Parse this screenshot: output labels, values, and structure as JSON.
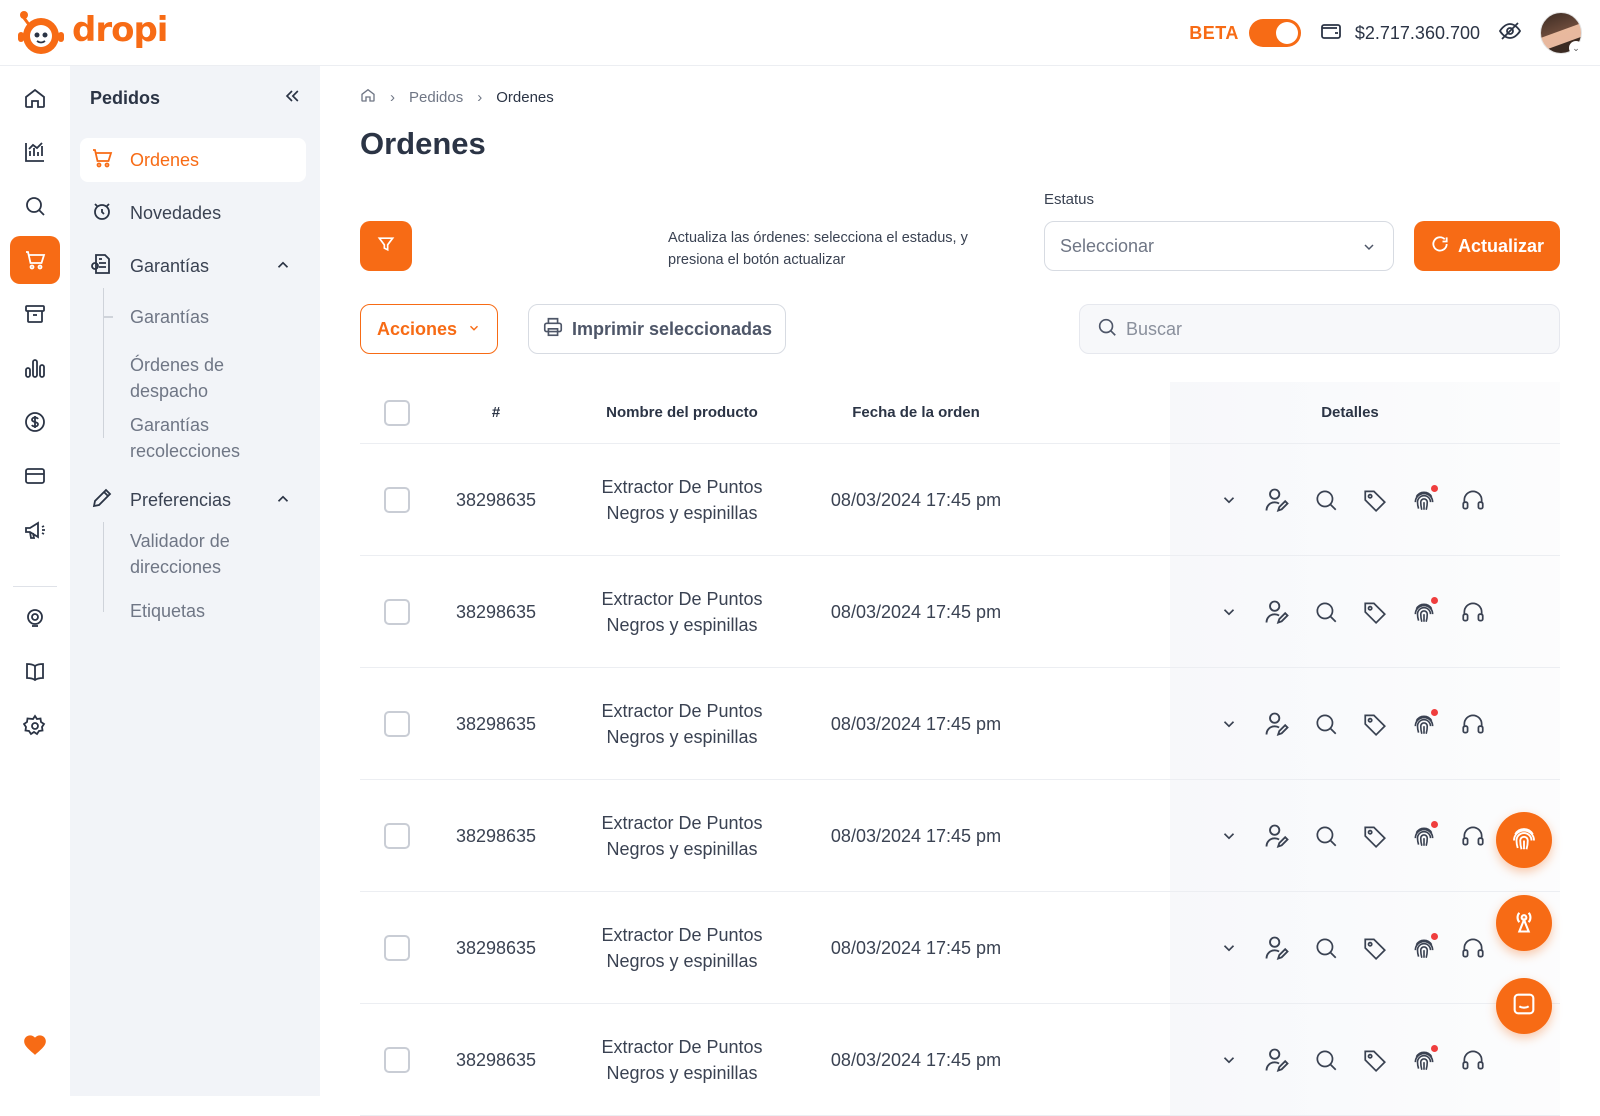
{
  "brand": {
    "name": "dropi",
    "color": "#f76b15"
  },
  "topbar": {
    "beta_label": "BETA",
    "beta_enabled": true,
    "balance": "$2.717.360.700",
    "wallet_icon": "wallet-icon",
    "hide_balance_icon": "eye-off-icon"
  },
  "rail": {
    "items": [
      "home-icon",
      "chart-icon",
      "search-icon",
      "cart-icon",
      "archive-icon",
      "bars-icon",
      "dollar-icon",
      "card-icon",
      "megaphone-icon",
      "support-icon",
      "book-icon",
      "gear-icon"
    ],
    "active": "cart-icon",
    "footer_icon": "heart-icon"
  },
  "sidebar": {
    "title": "Pedidos",
    "items": [
      {
        "label": "Ordenes",
        "icon": "cart-icon",
        "active": true
      },
      {
        "label": "Novedades",
        "icon": "clock-refresh-icon"
      },
      {
        "label": "Garantías",
        "icon": "document-icon",
        "expanded": true,
        "children": [
          "Garantías",
          "Órdenes de despacho",
          "Garantías recolecciones"
        ]
      },
      {
        "label": "Preferencias",
        "icon": "pencil-icon",
        "expanded": true,
        "children": [
          "Validador de direcciones",
          "Etiquetas"
        ]
      }
    ]
  },
  "breadcrumb": {
    "items": [
      "Pedidos",
      "Ordenes"
    ]
  },
  "page": {
    "title": "Ordenes",
    "hint": "Actualiza las órdenes: selecciona el estadus, y presiona el botón actualizar",
    "status_label": "Estatus",
    "status_placeholder": "Seleccionar",
    "update_label": "Actualizar",
    "actions_label": "Acciones",
    "print_label": "Imprimir seleccionadas",
    "search_placeholder": "Buscar"
  },
  "table": {
    "columns": [
      "#",
      "Nombre del producto",
      "Fecha de la orden",
      "Detalles"
    ],
    "rows": [
      {
        "id": "38298635",
        "product_line1": "Extractor De Puntos",
        "product_line2": "Negros y espinillas",
        "date": "08/03/2024 17:45 pm"
      },
      {
        "id": "38298635",
        "product_line1": "Extractor De Puntos",
        "product_line2": "Negros y espinillas",
        "date": "08/03/2024 17:45 pm"
      },
      {
        "id": "38298635",
        "product_line1": "Extractor De Puntos",
        "product_line2": "Negros y espinillas",
        "date": "08/03/2024 17:45 pm"
      },
      {
        "id": "38298635",
        "product_line1": "Extractor De Puntos",
        "product_line2": "Negros y espinillas",
        "date": "08/03/2024 17:45 pm"
      },
      {
        "id": "38298635",
        "product_line1": "Extractor De Puntos",
        "product_line2": "Negros y espinillas",
        "date": "08/03/2024 17:45 pm"
      },
      {
        "id": "38298635",
        "product_line1": "Extractor De Puntos",
        "product_line2": "Negros y espinillas",
        "date": "08/03/2024 17:45 pm"
      }
    ],
    "row_icons": [
      "chevron-down-icon",
      "user-edit-icon",
      "magnifier-icon",
      "tag-icon",
      "fingerprint-icon",
      "headset-icon"
    ]
  },
  "fabs": [
    "fingerprint-icon",
    "broadcast-icon",
    "chat-icon"
  ]
}
